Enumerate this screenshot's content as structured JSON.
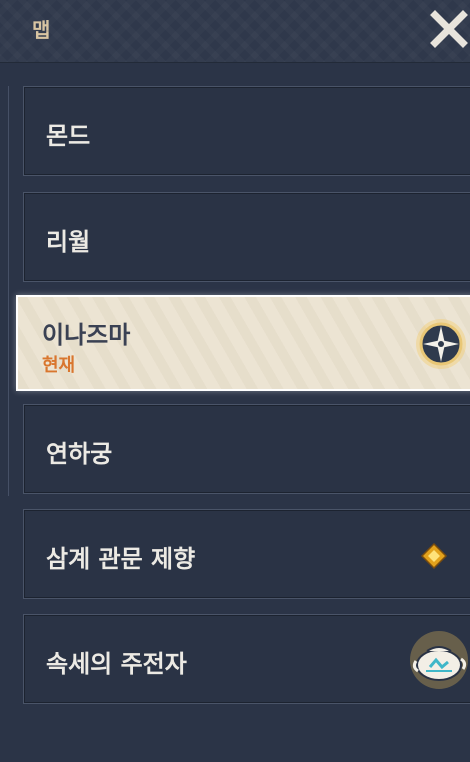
{
  "header": {
    "title": "맵"
  },
  "map_list": {
    "items": [
      {
        "label": "몬드"
      },
      {
        "label": "리월"
      },
      {
        "label": "이나즈마",
        "sub": "현재"
      },
      {
        "label": "연하궁"
      },
      {
        "label": "삼계 관문 제향"
      },
      {
        "label": "속세의 주전자"
      }
    ]
  },
  "icons": {
    "close": "close-icon",
    "current_location": "compass-icon",
    "chasm_marker": "diamond-marker-icon",
    "serenitea_pot": "teapot-icon"
  },
  "colors": {
    "panel_bg": "#2b3447",
    "active_bg": "#ece4d3",
    "accent_orange": "#d9762e",
    "title_gold": "#d8c4a2"
  }
}
